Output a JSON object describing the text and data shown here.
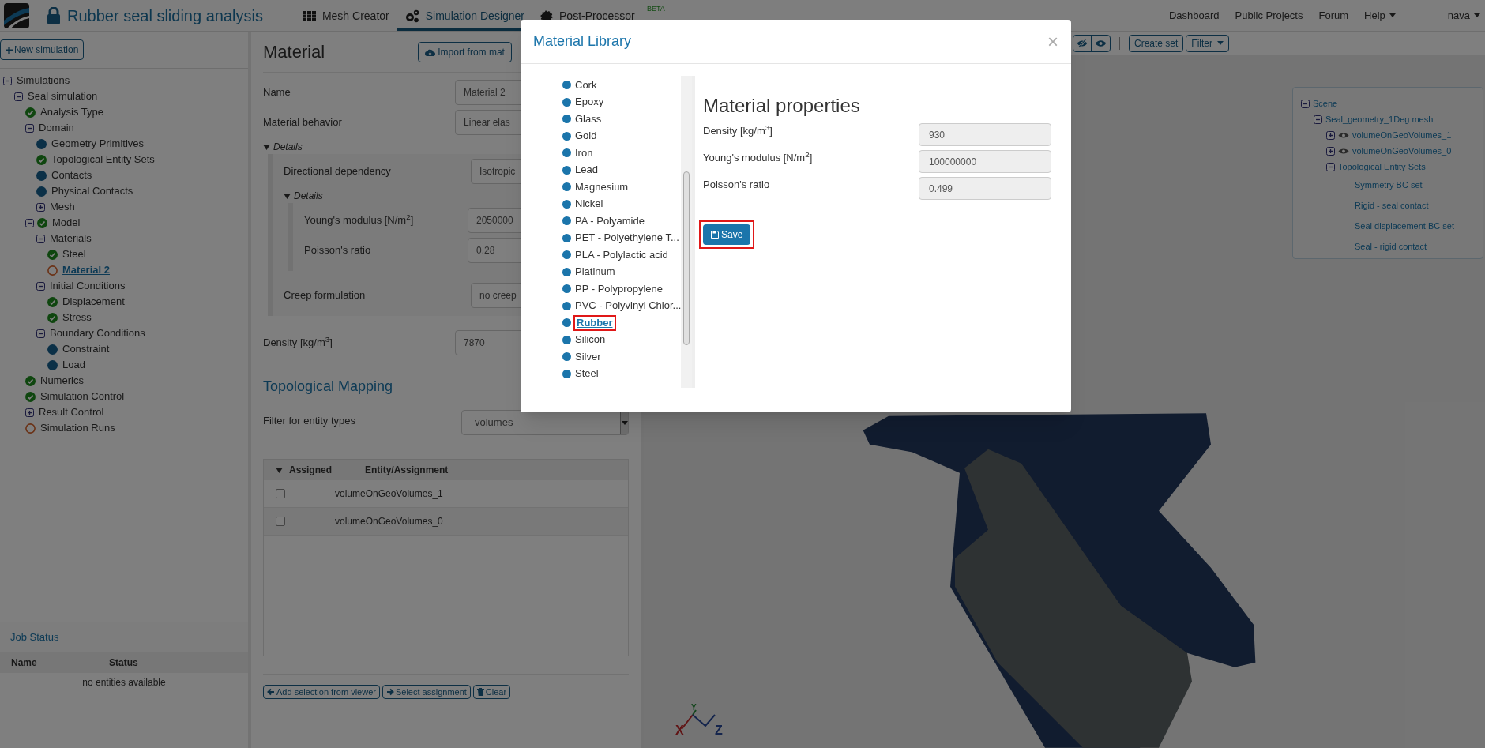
{
  "header": {
    "title": "Rubber seal sliding analysis",
    "nav_tabs": [
      {
        "label": "Mesh Creator",
        "selected": false
      },
      {
        "label": "Simulation Designer",
        "selected": true
      },
      {
        "label": "Post-Processor",
        "selected": false,
        "badge": "BETA"
      }
    ],
    "menu": [
      {
        "label": "Dashboard",
        "dropdown": false
      },
      {
        "label": "Public Projects",
        "dropdown": false
      },
      {
        "label": "Forum",
        "dropdown": false
      },
      {
        "label": "Help",
        "dropdown": true
      },
      {
        "label": "nava",
        "dropdown": true
      }
    ]
  },
  "sidebar": {
    "new_button": "New simulation",
    "tree": [
      {
        "label": "Simulations",
        "expanded": true,
        "selected": false,
        "children": [
          {
            "label": "Seal simulation",
            "expanded": true,
            "selected": false,
            "children": [
              {
                "label": "Analysis Type",
                "kind": "check",
                "selected": false
              },
              {
                "label": "Domain",
                "expanded": true,
                "selected": false,
                "children": [
                  {
                    "label": "Geometry Primitives",
                    "kind": "dot",
                    "selected": false
                  },
                  {
                    "label": "Topological Entity Sets",
                    "kind": "check",
                    "selected": false
                  },
                  {
                    "label": "Contacts",
                    "kind": "dot",
                    "selected": false
                  },
                  {
                    "label": "Physical Contacts",
                    "kind": "dot",
                    "selected": false
                  },
                  {
                    "label": "Mesh",
                    "expanded": false,
                    "selected": false
                  }
                ]
              },
              {
                "label": "Model",
                "kind": "check",
                "expanded": true,
                "selected": false,
                "children": [
                  {
                    "label": "Materials",
                    "expanded": true,
                    "selected": false,
                    "children": [
                      {
                        "label": "Steel",
                        "kind": "check",
                        "selected": false
                      },
                      {
                        "label": "Material 2",
                        "kind": "ring",
                        "selected": true
                      }
                    ]
                  },
                  {
                    "label": "Initial Conditions",
                    "expanded": true,
                    "selected": false,
                    "children": [
                      {
                        "label": "Displacement",
                        "kind": "check",
                        "selected": false
                      },
                      {
                        "label": "Stress",
                        "kind": "check",
                        "selected": false
                      }
                    ]
                  },
                  {
                    "label": "Boundary Conditions",
                    "expanded": true,
                    "selected": false,
                    "children": [
                      {
                        "label": "Constraint",
                        "kind": "dot",
                        "selected": false
                      },
                      {
                        "label": "Load",
                        "kind": "dot",
                        "selected": false
                      }
                    ]
                  }
                ]
              },
              {
                "label": "Numerics",
                "kind": "check",
                "selected": false
              },
              {
                "label": "Simulation Control",
                "kind": "check",
                "selected": false
              },
              {
                "label": "Result Control",
                "expanded": false,
                "selected": false
              },
              {
                "label": "Simulation Runs",
                "kind": "ring",
                "selected": false
              }
            ]
          }
        ]
      }
    ],
    "job_status": {
      "title": "Job Status",
      "columns": [
        "Name",
        "Status"
      ],
      "empty": "no entities available"
    }
  },
  "material_panel": {
    "title": "Material",
    "import_button": "Import from mat",
    "fields": [
      {
        "label": "Name",
        "value": "Material 2"
      },
      {
        "label": "Material behavior",
        "value": "Linear elas"
      }
    ],
    "details": {
      "title": "Details",
      "expanded": true,
      "fields": [
        {
          "label": "Directional dependency",
          "value": "Isotropic"
        }
      ],
      "details": {
        "title": "Details",
        "expanded": true,
        "fields": [
          {
            "label": "Young's modulus [N/m$^{2}$]",
            "value": "2050000"
          },
          {
            "label": "Poisson's ratio",
            "value": "0.28"
          }
        ]
      },
      "after_fields": [
        {
          "label": "Creep formulation",
          "value": "no creep"
        }
      ]
    },
    "density": {
      "label": "Density [kg/m$^{3}$]",
      "value": "7870"
    },
    "mapping": {
      "title": "Topological Mapping",
      "filter_label": "Filter for entity types",
      "filter_value": "volumes",
      "columns": [
        "Assigned",
        "Entity/Assignment"
      ],
      "rows": [
        {
          "entity": "volumeOnGeoVolumes_1",
          "checked": false
        },
        {
          "entity": "volumeOnGeoVolumes_0",
          "checked": false
        }
      ],
      "buttons": [
        {
          "kind": "left",
          "label": "Add selection from viewer"
        },
        {
          "kind": "right",
          "label": "Select assignment"
        },
        {
          "kind": "trash",
          "label": "Clear"
        }
      ]
    }
  },
  "viewer": {
    "toolbar": [
      {
        "label": "Create set",
        "dropdown": false
      },
      {
        "label": "Filter",
        "dropdown": true
      }
    ],
    "scene_tree": [
      {
        "label": "Scene",
        "expanded": true,
        "children": [
          {
            "label": "Seal_geometry_1Deg mesh",
            "expanded": true,
            "children": [
              {
                "label": "volumeOnGeoVolumes_1",
                "expanded": false,
                "visible": true
              },
              {
                "label": "volumeOnGeoVolumes_0",
                "expanded": false,
                "visible": true
              },
              {
                "label": "Topological Entity Sets",
                "expanded": true,
                "children": [
                  {
                    "label": "Symmetry BC set"
                  },
                  {
                    "label": "Rigid - seal contact"
                  },
                  {
                    "label": "Seal displacement BC set"
                  },
                  {
                    "label": "Seal - rigid contact"
                  }
                ]
              }
            ]
          }
        ]
      }
    ],
    "axes": [
      "X",
      "Y",
      "Z"
    ]
  },
  "modal": {
    "title": "Material Library",
    "close": "×",
    "materials": [
      {
        "label": "Cork",
        "selected": false
      },
      {
        "label": "Epoxy",
        "selected": false
      },
      {
        "label": "Glass",
        "selected": false
      },
      {
        "label": "Gold",
        "selected": false
      },
      {
        "label": "Iron",
        "selected": false
      },
      {
        "label": "Lead",
        "selected": false
      },
      {
        "label": "Magnesium",
        "selected": false
      },
      {
        "label": "Nickel",
        "selected": false
      },
      {
        "label": "PA - Polyamide",
        "selected": false
      },
      {
        "label": "PET - Polyethylene T...",
        "selected": false
      },
      {
        "label": "PLA - Polylactic acid",
        "selected": false
      },
      {
        "label": "Platinum",
        "selected": false
      },
      {
        "label": "PP - Polypropylene",
        "selected": false
      },
      {
        "label": "PVC - Polyvinyl Chlor...",
        "selected": false
      },
      {
        "label": "Rubber",
        "selected": true
      },
      {
        "label": "Silicon",
        "selected": false
      },
      {
        "label": "Silver",
        "selected": false
      },
      {
        "label": "Steel",
        "selected": false
      }
    ],
    "properties_title": "Material properties",
    "properties": [
      {
        "label": "Density [kg/m$^{3}$]",
        "value": "930"
      },
      {
        "label": "Young's modulus [N/m$^{2}$]",
        "value": "100000000"
      },
      {
        "label": "Poisson's ratio",
        "value": "0.499"
      }
    ],
    "save_button": {
      "label": "Save",
      "highlighted": true
    }
  }
}
